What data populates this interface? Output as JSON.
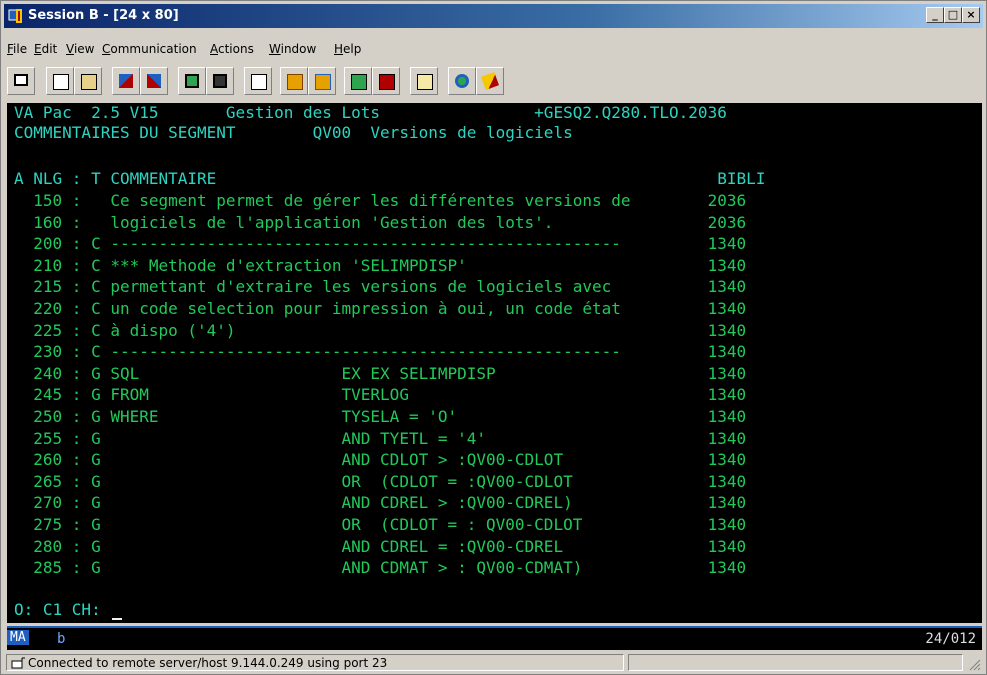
{
  "window": {
    "title": "Session B - [24 x 80]"
  },
  "menu": [
    "File",
    "Edit",
    "View",
    "Communication",
    "Actions",
    "Window",
    "Help"
  ],
  "toolbar": [
    "monitor-icon",
    "copy-icon",
    "paste-icon",
    "send-icon",
    "receive-icon",
    "screen-icon",
    "screen-alt-icon",
    "macro-icon",
    "record-icon",
    "playback-icon",
    "run-icon",
    "stop-icon",
    "clipboard-icon",
    "globe-icon",
    "pencil-icon"
  ],
  "terminal": {
    "lines": [
      {
        "text": "VA Pac  2.5 V15       Gestion des Lots                +GESQ2.Q280.TLO.2036",
        "style": "cyan"
      },
      {
        "text": "COMMENTAIRES DU SEGMENT        QV00  Versions de logiciels",
        "style": "cyan"
      },
      {
        "text": "",
        "style": "cyan"
      },
      {
        "text": "A NLG : T COMMENTAIRE                                                    BIBLI",
        "style": "cyan"
      },
      {
        "text": "  150 :   Ce segment permet de gérer les différentes versions de        2036",
        "style": "green"
      },
      {
        "text": "  160 :   logiciels de l'application 'Gestion des lots'.                2036",
        "style": "green"
      },
      {
        "text": "  200 : C -----------------------------------------------------         1340",
        "style": "green"
      },
      {
        "text": "  210 : C *** Methode d'extraction 'SELIMPDISP'                         1340",
        "style": "green"
      },
      {
        "text": "  215 : C permettant d'extraire les versions de logiciels avec          1340",
        "style": "green"
      },
      {
        "text": "  220 : C un code selection pour impression à oui, un code état         1340",
        "style": "green"
      },
      {
        "text": "  225 : C à dispo ('4')                                                 1340",
        "style": "green"
      },
      {
        "text": "  230 : C -----------------------------------------------------         1340",
        "style": "green"
      },
      {
        "text": "  240 : G SQL                     EX EX SELIMPDISP                      1340",
        "style": "green"
      },
      {
        "text": "  245 : G FROM                    TVERLOG                               1340",
        "style": "green"
      },
      {
        "text": "  250 : G WHERE                   TYSELA = 'O'                          1340",
        "style": "green"
      },
      {
        "text": "  255 : G                         AND TYETL = '4'                       1340",
        "style": "green"
      },
      {
        "text": "  260 : G                         AND CDLOT > :QV00-CDLOT               1340",
        "style": "green"
      },
      {
        "text": "  265 : G                         OR  (CDLOT = :QV00-CDLOT              1340",
        "style": "green"
      },
      {
        "text": "  270 : G                         AND CDREL > :QV00-CDREL)              1340",
        "style": "green"
      },
      {
        "text": "  275 : G                         OR  (CDLOT = : QV00-CDLOT             1340",
        "style": "green"
      },
      {
        "text": "  280 : G                         AND CDREL = :QV00-CDREL               1340",
        "style": "green"
      },
      {
        "text": "  285 : G                         AND CDMAT > : QV00-CDMAT)             1340",
        "style": "green"
      },
      {
        "text": "",
        "style": "green"
      }
    ],
    "command_line": "O: C1 CH: "
  },
  "oia": {
    "mode": "MA",
    "indicator": "b",
    "cursor_pos": "24/012"
  },
  "status": {
    "text": "Connected to remote server/host 9.144.0.249 using port 23"
  }
}
